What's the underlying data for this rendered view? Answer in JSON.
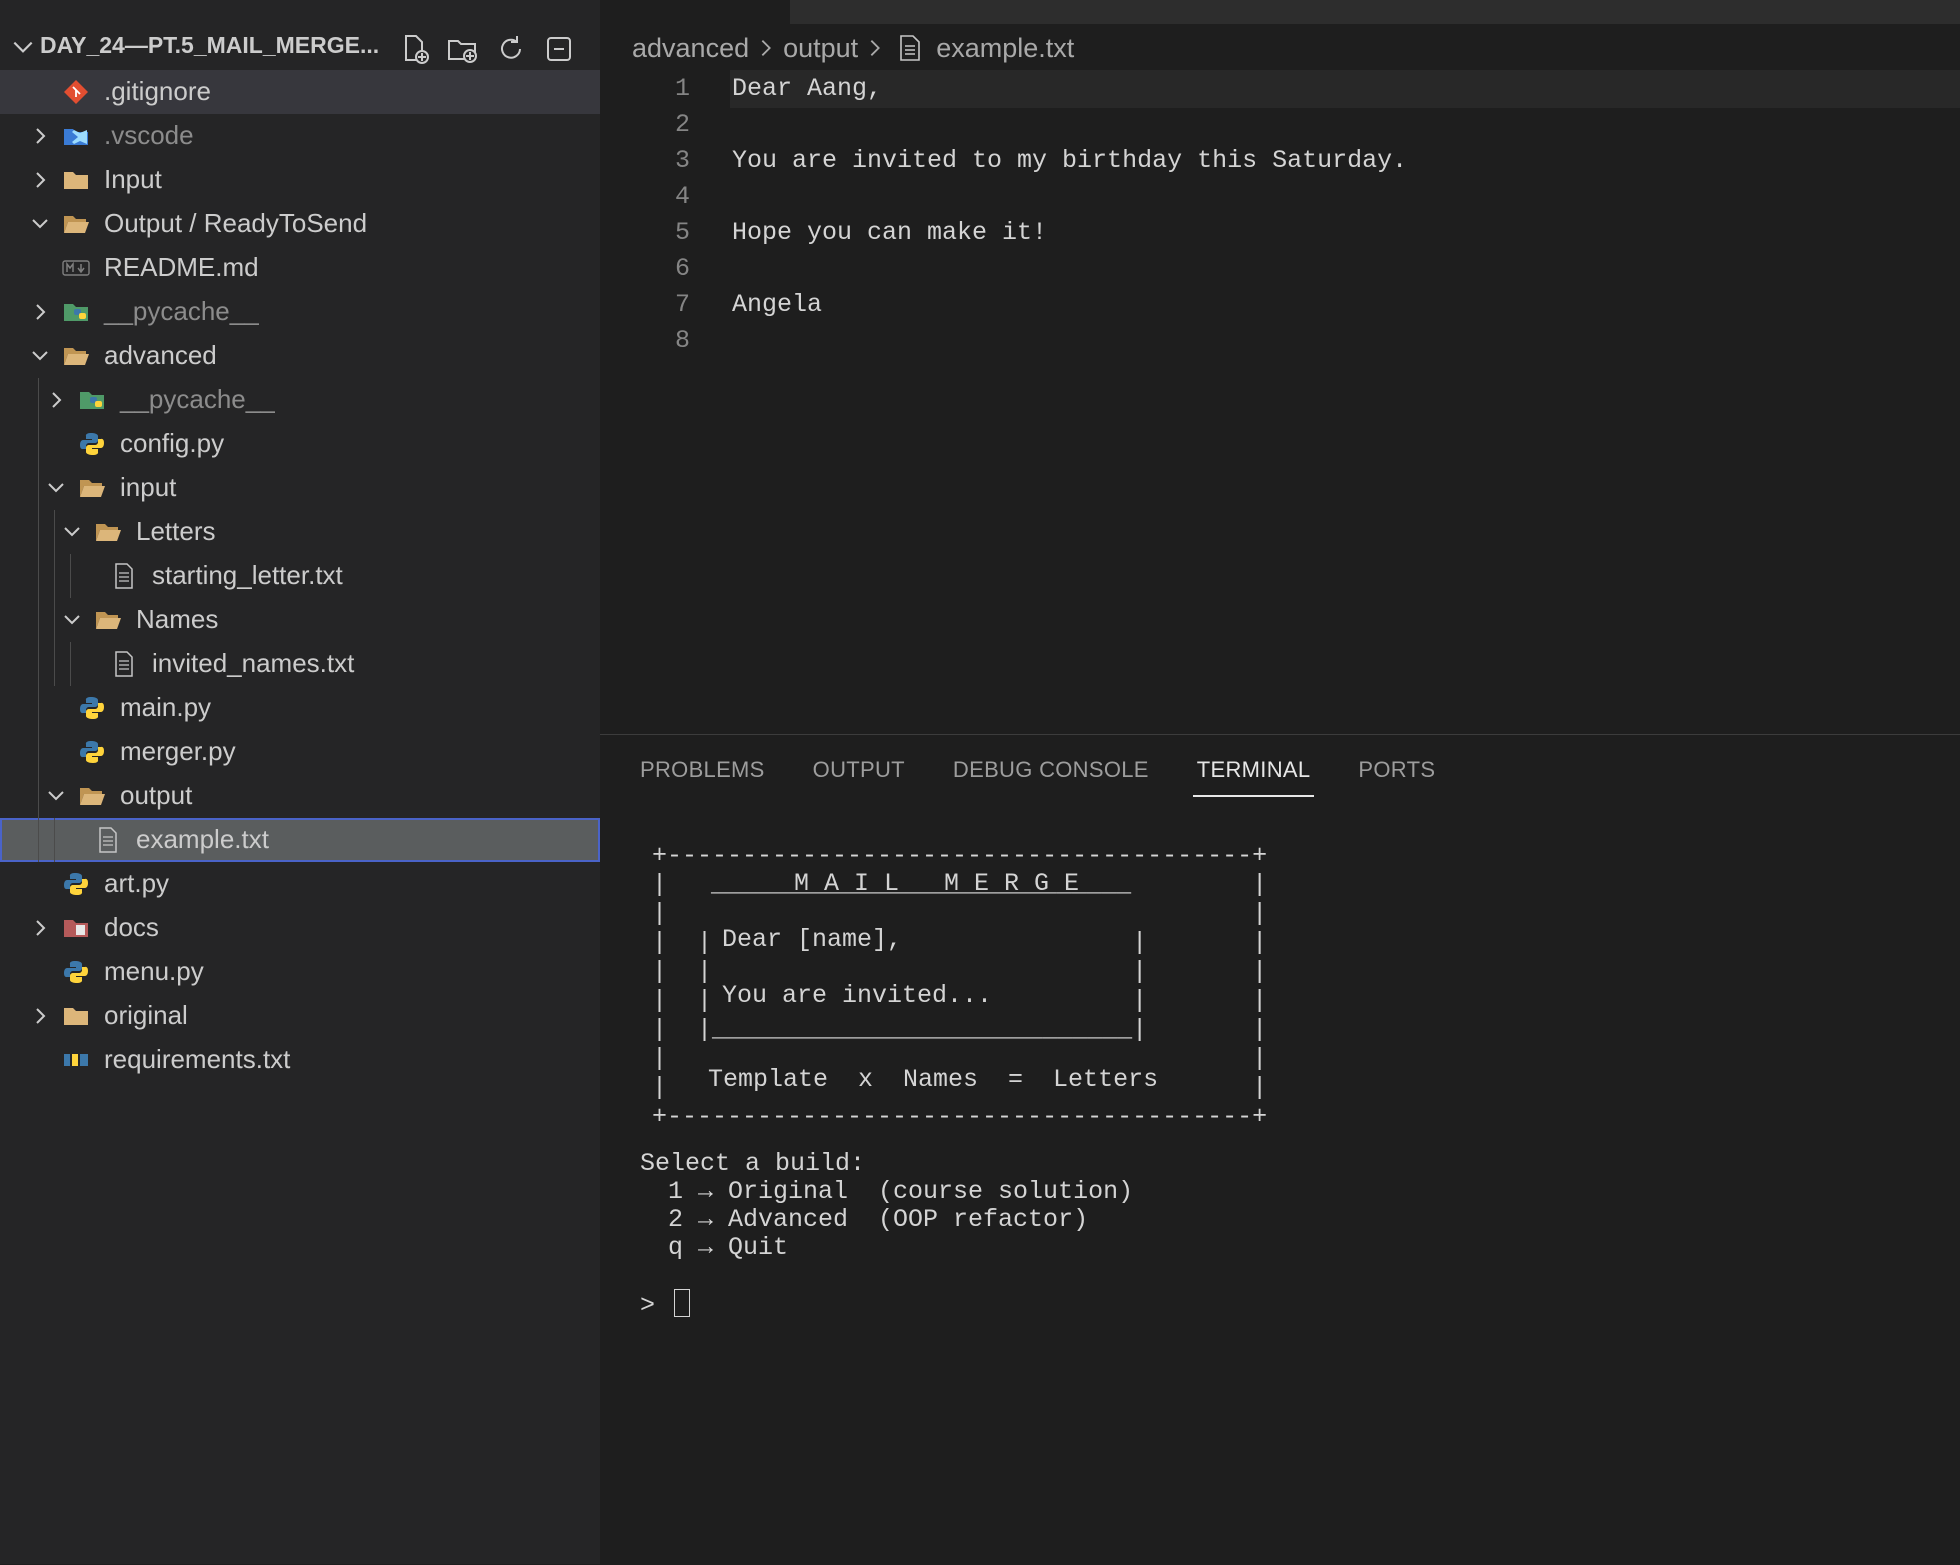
{
  "sidebar": {
    "title": "DAY_24—PT.5_MAIL_MERGE...",
    "actions": [
      "new-file-icon",
      "new-folder-icon",
      "refresh-icon",
      "collapse-all-icon"
    ],
    "items": [
      {
        "label": ".gitignore",
        "icon": "git-icon",
        "twistie": "none",
        "depth": 0,
        "dim": false
      },
      {
        "label": ".vscode",
        "icon": "vscode-folder-icon",
        "twistie": "right",
        "depth": 0,
        "dim": true
      },
      {
        "label": "Input",
        "icon": "folder-icon",
        "twistie": "right",
        "depth": 0,
        "dim": false
      },
      {
        "label": "Output / ReadyToSend",
        "icon": "folder-open-icon",
        "twistie": "down",
        "depth": 0,
        "dim": false
      },
      {
        "label": "README.md",
        "icon": "markdown-icon",
        "twistie": "none",
        "depth": 0,
        "dim": false
      },
      {
        "label": "__pycache__",
        "icon": "python-folder-icon",
        "twistie": "right",
        "depth": 0,
        "dim": true
      },
      {
        "label": "advanced",
        "icon": "folder-open-icon",
        "twistie": "down",
        "depth": 0,
        "dim": false
      },
      {
        "label": "__pycache__",
        "icon": "python-folder-icon",
        "twistie": "right",
        "depth": 1,
        "dim": true
      },
      {
        "label": "config.py",
        "icon": "python-icon",
        "twistie": "none",
        "depth": 1,
        "dim": false
      },
      {
        "label": "input",
        "icon": "folder-open-icon",
        "twistie": "down",
        "depth": 1,
        "dim": false
      },
      {
        "label": "Letters",
        "icon": "folder-open-icon",
        "twistie": "down",
        "depth": 2,
        "dim": false
      },
      {
        "label": "starting_letter.txt",
        "icon": "text-file-icon",
        "twistie": "none",
        "depth": 3,
        "dim": false
      },
      {
        "label": "Names",
        "icon": "folder-open-icon",
        "twistie": "down",
        "depth": 2,
        "dim": false
      },
      {
        "label": "invited_names.txt",
        "icon": "text-file-icon",
        "twistie": "none",
        "depth": 3,
        "dim": false
      },
      {
        "label": "main.py",
        "icon": "python-icon",
        "twistie": "none",
        "depth": 1,
        "dim": false
      },
      {
        "label": "merger.py",
        "icon": "python-icon",
        "twistie": "none",
        "depth": 1,
        "dim": false
      },
      {
        "label": "output",
        "icon": "folder-open-icon",
        "twistie": "down",
        "depth": 1,
        "dim": false
      },
      {
        "label": "example.txt",
        "icon": "text-file-icon",
        "twistie": "none",
        "depth": 2,
        "dim": false
      },
      {
        "label": "art.py",
        "icon": "python-icon",
        "twistie": "none",
        "depth": 0,
        "dim": false
      },
      {
        "label": "docs",
        "icon": "docs-folder-icon",
        "twistie": "right",
        "depth": 0,
        "dim": false
      },
      {
        "label": "menu.py",
        "icon": "python-icon",
        "twistie": "none",
        "depth": 0,
        "dim": false
      },
      {
        "label": "original",
        "icon": "folder-icon",
        "twistie": "right",
        "depth": 0,
        "dim": false
      },
      {
        "label": "requirements.txt",
        "icon": "pip-icon",
        "twistie": "none",
        "depth": 0,
        "dim": false
      }
    ]
  },
  "editor": {
    "breadcrumb": [
      "advanced",
      "output",
      "example.txt"
    ],
    "line_numbers": [
      "1",
      "2",
      "3",
      "4",
      "5",
      "6",
      "7",
      "8"
    ],
    "lines": [
      "Dear Aang,",
      "",
      "You are invited to my birthday this Saturday.",
      "",
      "Hope you can make it!",
      "",
      "Angela",
      ""
    ]
  },
  "panel": {
    "tabs": [
      "PROBLEMS",
      "OUTPUT",
      "DEBUG CONSOLE",
      "TERMINAL",
      "PORTS"
    ],
    "active_tab": "TERMINAL",
    "banner": {
      "title": "M A I L   M E R G E",
      "greeting": "Dear [name],",
      "body": "You are invited...",
      "formula": "Template  x  Names  =  Letters"
    },
    "menu": {
      "prompt": "Select a build:",
      "options": [
        "1 → Original  (course solution)",
        "2 → Advanced  (OOP refactor)",
        "q → Quit"
      ],
      "input_prompt": ">"
    }
  },
  "colors": {
    "accent": "#4a63c8",
    "folder": "#dcb67a",
    "python_blue": "#3c78aa",
    "python_yellow": "#ffd43b",
    "git": "#e24e31"
  }
}
